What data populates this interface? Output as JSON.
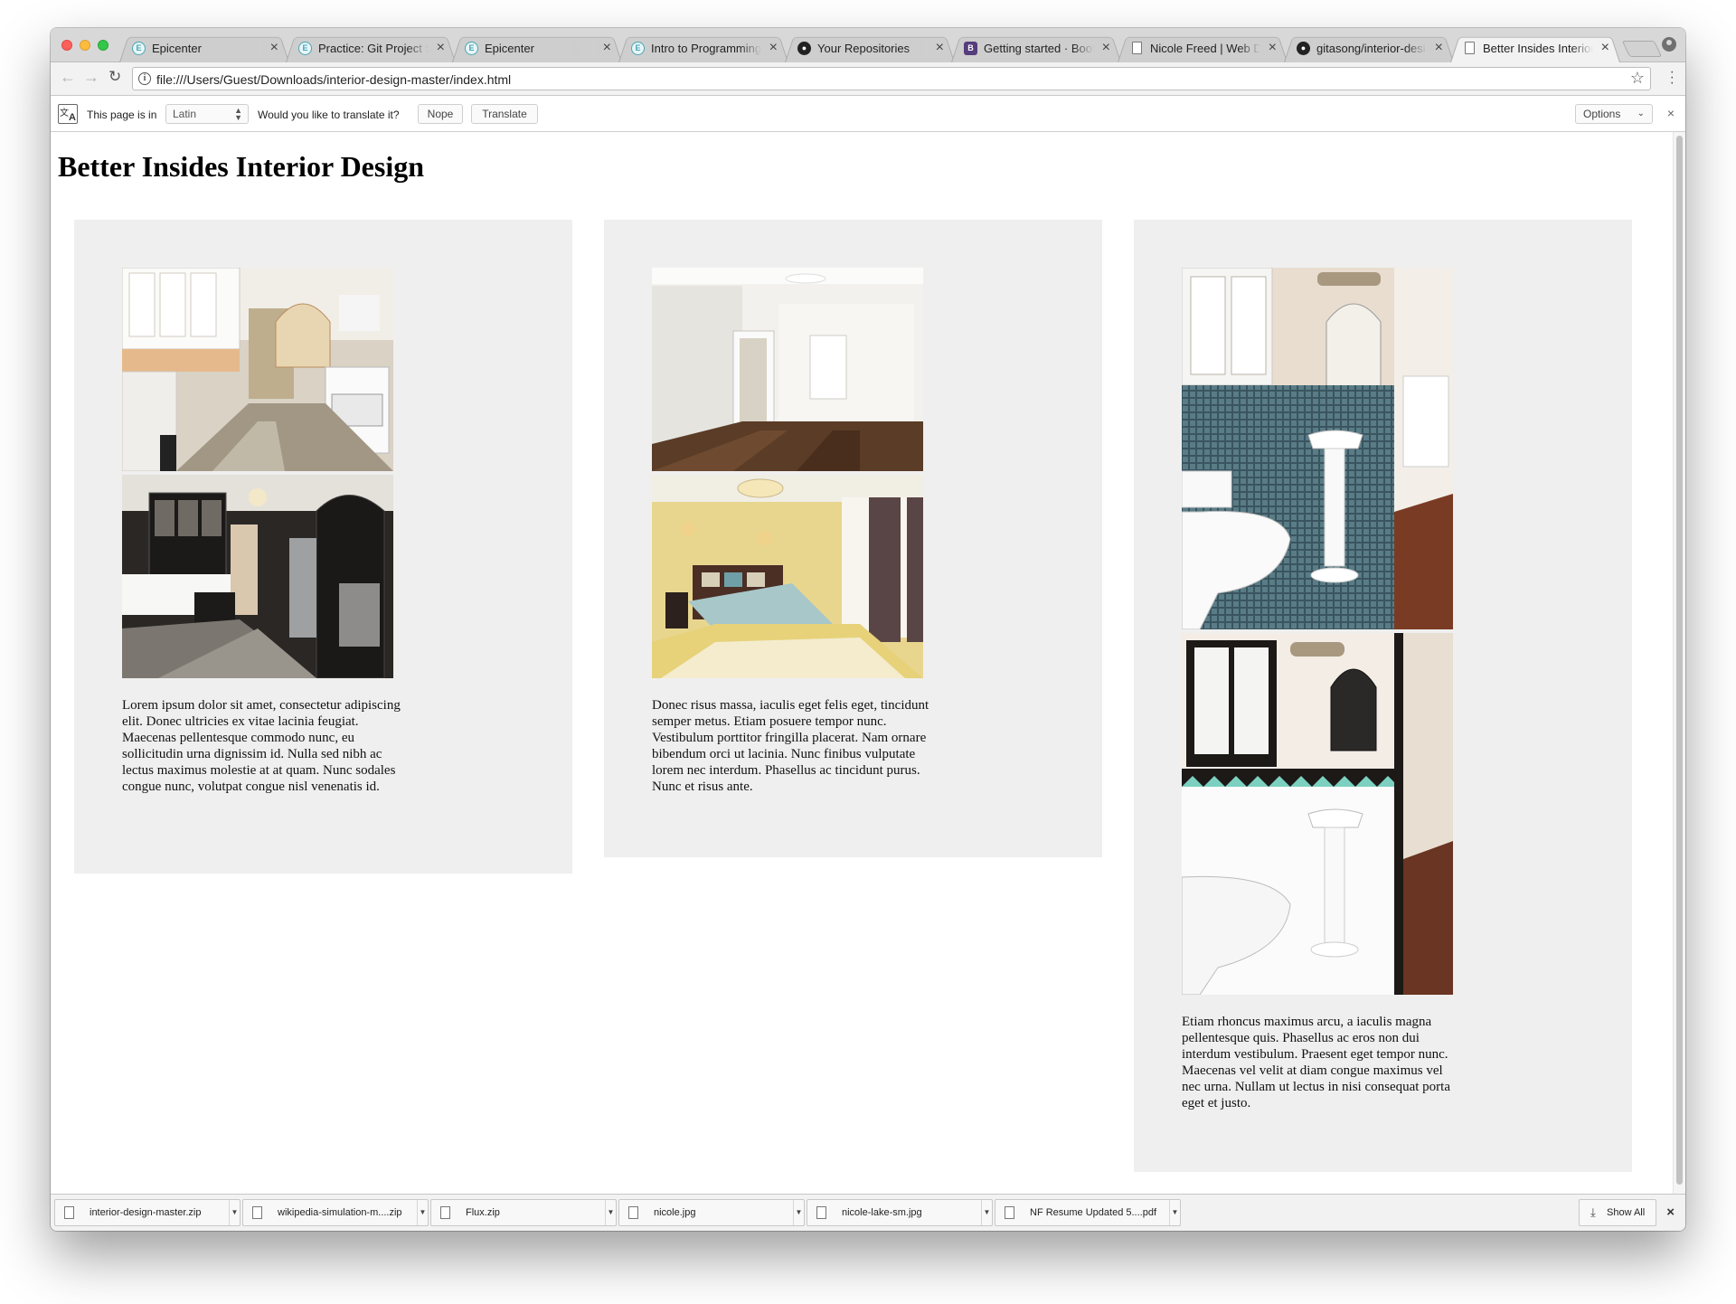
{
  "browser": {
    "tabs": [
      {
        "label": "Epicenter",
        "icon": "epicenter-icon"
      },
      {
        "label": "Practice: Git Project Se",
        "icon": "epicenter-icon"
      },
      {
        "label": "Epicenter",
        "icon": "epicenter-icon"
      },
      {
        "label": "Intro to Programming",
        "icon": "epicenter-icon"
      },
      {
        "label": "Your Repositories",
        "icon": "github-icon"
      },
      {
        "label": "Getting started · Boots",
        "icon": "bootstrap-icon"
      },
      {
        "label": "Nicole Freed | Web De",
        "icon": "document-icon"
      },
      {
        "label": "gitasong/interior-desig",
        "icon": "github-icon"
      },
      {
        "label": "Better Insides Interior D",
        "icon": "document-icon"
      }
    ],
    "url": "file:///Users/Guest/Downloads/interior-design-master/index.html",
    "translate_bar": {
      "prefix": "This page is in",
      "language": "Latin",
      "question": "Would you like to translate it?",
      "nope": "Nope",
      "translate": "Translate",
      "options": "Options"
    }
  },
  "page": {
    "title": "Better Insides Interior Design",
    "cards": [
      {
        "text": "Lorem ipsum dolor sit amet, consectetur adipiscing elit. Donec ultricies ex vitae lacinia feugiat. Maecenas pellentesque commodo nunc, eu sollicitudin urna dignissim id. Nulla sed nibh ac lectus maximus molestie at at quam. Nunc sodales congue nunc, volutpat congue nisl venenatis id."
      },
      {
        "text": "Donec risus massa, iaculis eget felis eget, tincidunt semper metus. Etiam posuere tempor nunc. Vestibulum porttitor fringilla placerat. Nam ornare bibendum orci ut lacinia. Nunc finibus vulputate lorem nec interdum. Phasellus ac tincidunt purus. Nunc et risus ante."
      },
      {
        "text": "Etiam rhoncus maximus arcu, a iaculis magna pellentesque quis. Phasellus ac eros non dui interdum vestibulum. Praesent eget tempor nunc. Maecenas vel velit at diam congue maximus vel nec urna. Nullam ut lectus in nisi consequat porta eget et justo."
      }
    ]
  },
  "downloads": {
    "items": [
      "interior-design-master.zip",
      "wikipedia-simulation-m....zip",
      "Flux.zip",
      "nicole.jpg",
      "nicole-lake-sm.jpg",
      "NF Resume Updated 5....pdf"
    ],
    "show_all": "Show All"
  }
}
